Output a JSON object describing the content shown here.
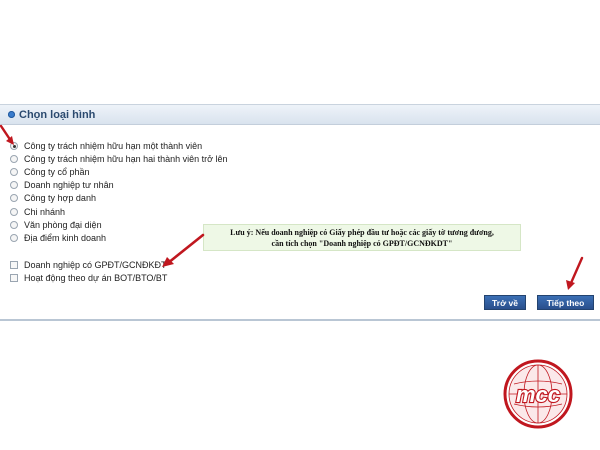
{
  "panel": {
    "title": "Chọn loại hình"
  },
  "options": [
    {
      "label": "Công ty trách nhiệm hữu hạn một thành viên",
      "selected": true
    },
    {
      "label": "Công ty trách nhiệm hữu hạn hai thành viên trở lên",
      "selected": false
    },
    {
      "label": "Công ty cổ phần",
      "selected": false
    },
    {
      "label": "Doanh nghiệp tư nhân",
      "selected": false
    },
    {
      "label": "Công ty hợp danh",
      "selected": false
    },
    {
      "label": "Chi nhánh",
      "selected": false
    },
    {
      "label": "Văn phòng đại diện",
      "selected": false
    },
    {
      "label": "Địa điểm kinh doanh",
      "selected": false
    }
  ],
  "checkboxes": [
    {
      "label": "Doanh nghiệp có GPĐT/GCNĐKĐT",
      "checked": false
    },
    {
      "label": "Hoạt động theo dự án BOT/BTO/BT",
      "checked": false
    }
  ],
  "note": {
    "line1": "Lưu ý: Nếu doanh nghiệp có Giấy phép đầu tư hoặc các giấy tờ tương đương,",
    "line2": "cần tích chọn \"Doanh nghiệp có GPĐT/GCNĐKDT\""
  },
  "buttons": {
    "back": "Trở về",
    "next": "Tiếp theo"
  },
  "logo": {
    "text": "mcc"
  },
  "colors": {
    "accent": "#2a4f8c",
    "arrow": "#c0171f",
    "note_bg": "#eef8e6"
  }
}
